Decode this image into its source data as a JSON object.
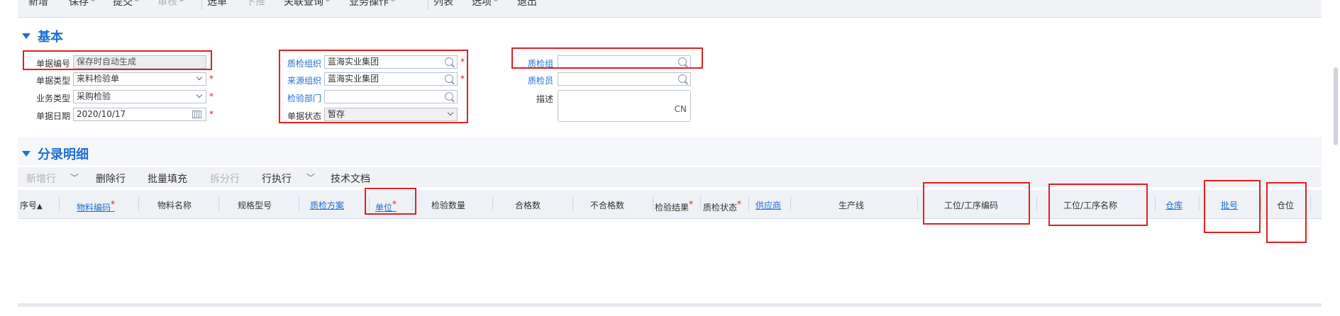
{
  "toolbar": {
    "new": "新增",
    "save": "保存",
    "submit": "提交",
    "audit": "审核",
    "select": "选单",
    "push": "下推",
    "linked_query": "关联查询",
    "business_ops": "业务操作",
    "list": "列表",
    "options": "选项",
    "exit": "退出"
  },
  "basic": {
    "title": "基本",
    "bill_no_label": "单据编号",
    "bill_no_value": "保存时自动生成",
    "bill_type_label": "单据类型",
    "bill_type_value": "来料检验单",
    "biz_type_label": "业务类型",
    "biz_type_value": "采购检验",
    "date_label": "单据日期",
    "date_value": "2020/10/17",
    "qc_org_label": "质检组织",
    "qc_org_value": "蓝海实业集团",
    "source_org_label": "来源组织",
    "source_org_value": "蓝海实业集团",
    "qc_dept_label": "检验部门",
    "qc_dept_value": "",
    "status_label": "单据状态",
    "status_value": "暂存",
    "qc_group_label": "质检组",
    "qc_group_value": "",
    "inspector_label": "质检员",
    "inspector_value": "",
    "desc_label": "描述",
    "desc_lang": "CN",
    "required_mark": "*"
  },
  "entries": {
    "title": "分录明细",
    "add_row": "新增行",
    "delete_row": "删除行",
    "batch_fill": "批量填充",
    "split_row": "拆分行",
    "row_exec": "行执行",
    "tech_doc": "技术文档"
  },
  "grid": {
    "seq": "序号",
    "sort_up": "▲",
    "material_code": "物料编码",
    "material_name": "物料名称",
    "spec": "规格型号",
    "qc_scheme": "质检方案",
    "unit": "单位",
    "inspect_qty": "检验数量",
    "qualified_qty": "合格数",
    "unqualified_qty": "不合格数",
    "inspect_result": "检验结果",
    "qc_status": "质检状态",
    "supplier": "供应商",
    "production_line": "生产线",
    "station_code": "工位/工序编码",
    "station_name": "工位/工序名称",
    "warehouse": "仓库",
    "lot_no": "批号",
    "location": "仓位"
  },
  "colors": {
    "accent": "#1f6fd1",
    "required": "#e02020",
    "highlight_box": "#e02020"
  }
}
